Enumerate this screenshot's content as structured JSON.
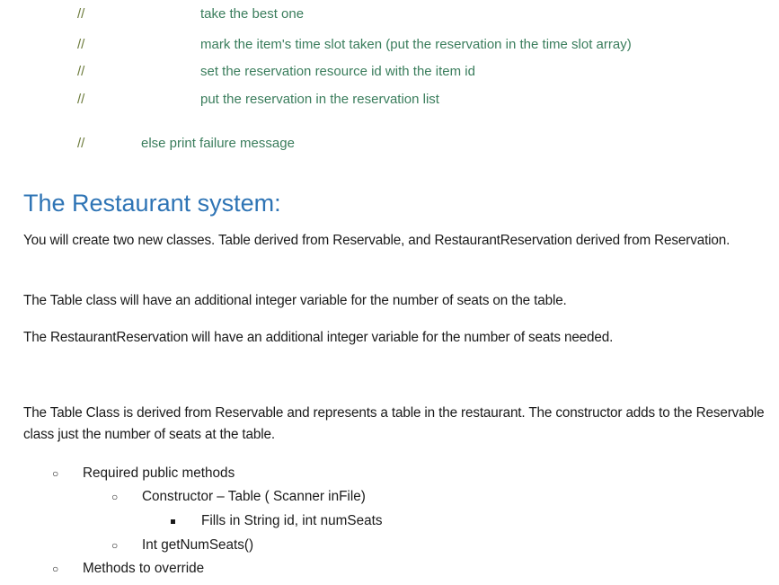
{
  "code_comments": [
    {
      "marker": "//",
      "text": "take the best one"
    },
    {
      "marker": "//",
      "text": "mark the item's time slot taken (put the reservation in the time slot array)"
    },
    {
      "marker": "//",
      "text": "set the reservation resource id with the item id"
    },
    {
      "marker": "//",
      "text": "put the reservation in the reservation list"
    },
    {
      "marker": "//",
      "text": "else print failure message"
    }
  ],
  "section": {
    "heading": "The Restaurant system:",
    "paragraphs": [
      "You will create two new classes.  Table derived from Reservable, and RestaurantReservation derived from Reservation.",
      "The Table class will have an additional integer variable for the number of seats on the table.",
      "The RestaurantReservation will have an additional integer variable for the number of seats needed.",
      "The Table Class is derived from Reservable and represents a table in the restaurant.  The constructor adds to the Reservable class just the number of seats at the table."
    ],
    "list": [
      {
        "level": 1,
        "bullet": "o",
        "text": "Required public methods"
      },
      {
        "level": 2,
        "bullet": "o",
        "text": "Constructor – Table ( Scanner inFile)"
      },
      {
        "level": 3,
        "bullet": "square",
        "text": "Fills in String id, int numSeats"
      },
      {
        "level": 2,
        "bullet": "o",
        "text": "Int getNumSeats()"
      },
      {
        "level": 1,
        "bullet": "o",
        "text": "Methods to override"
      }
    ]
  },
  "colors": {
    "comment_text": "#3a7d5c",
    "comment_marker": "#6b7a3a",
    "heading": "#2e74b5",
    "body_text": "#1a1a1a"
  }
}
